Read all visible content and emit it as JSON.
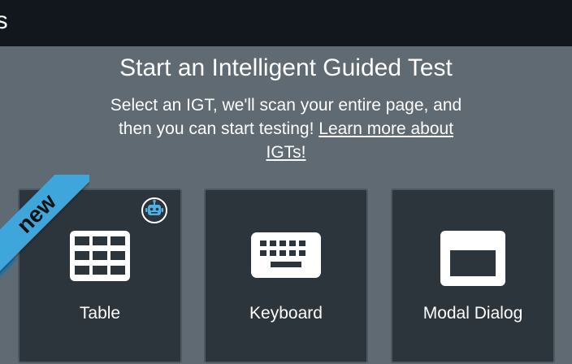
{
  "topbar": {
    "title": "ls"
  },
  "intro": {
    "heading": "Start an Intelligent Guided Test",
    "description": "Select an IGT, we'll scan your entire page, and then you can start testing!",
    "link_text": "Learn more about IGTs!"
  },
  "cards": [
    {
      "label": "Table",
      "icon": "table-icon",
      "badge": "new",
      "tag_icon": "robot-icon"
    },
    {
      "label": "Keyboard",
      "icon": "keyboard-icon"
    },
    {
      "label": "Modal Dialog",
      "icon": "modal-dialog-icon"
    }
  ],
  "colors": {
    "background": "#5f6a72",
    "topbar": "#11171d",
    "card": "#2c353c",
    "card_border": "#4d5861",
    "ribbon": "#3fa6dc",
    "text": "#ffffff"
  }
}
